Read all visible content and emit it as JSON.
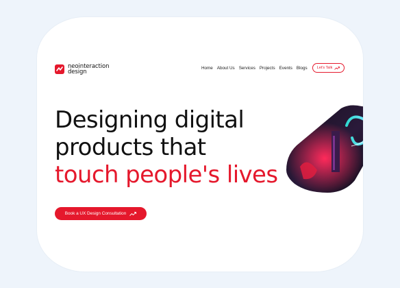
{
  "brand": {
    "line1": "neointeraction",
    "line2": "design",
    "color": "#e5182c"
  },
  "nav": {
    "items": [
      "Home",
      "About Us",
      "Services",
      "Projects",
      "Events",
      "Blogs"
    ],
    "talk_label": "Let's Talk"
  },
  "hero": {
    "line1": "Designing digital",
    "line2": "products that",
    "line3": "touch people's lives"
  },
  "cta": {
    "label": "Book a UX Design Consultation"
  },
  "icons": {
    "logo": "logo-mark-icon",
    "arrow": "trend-arrow-icon"
  }
}
